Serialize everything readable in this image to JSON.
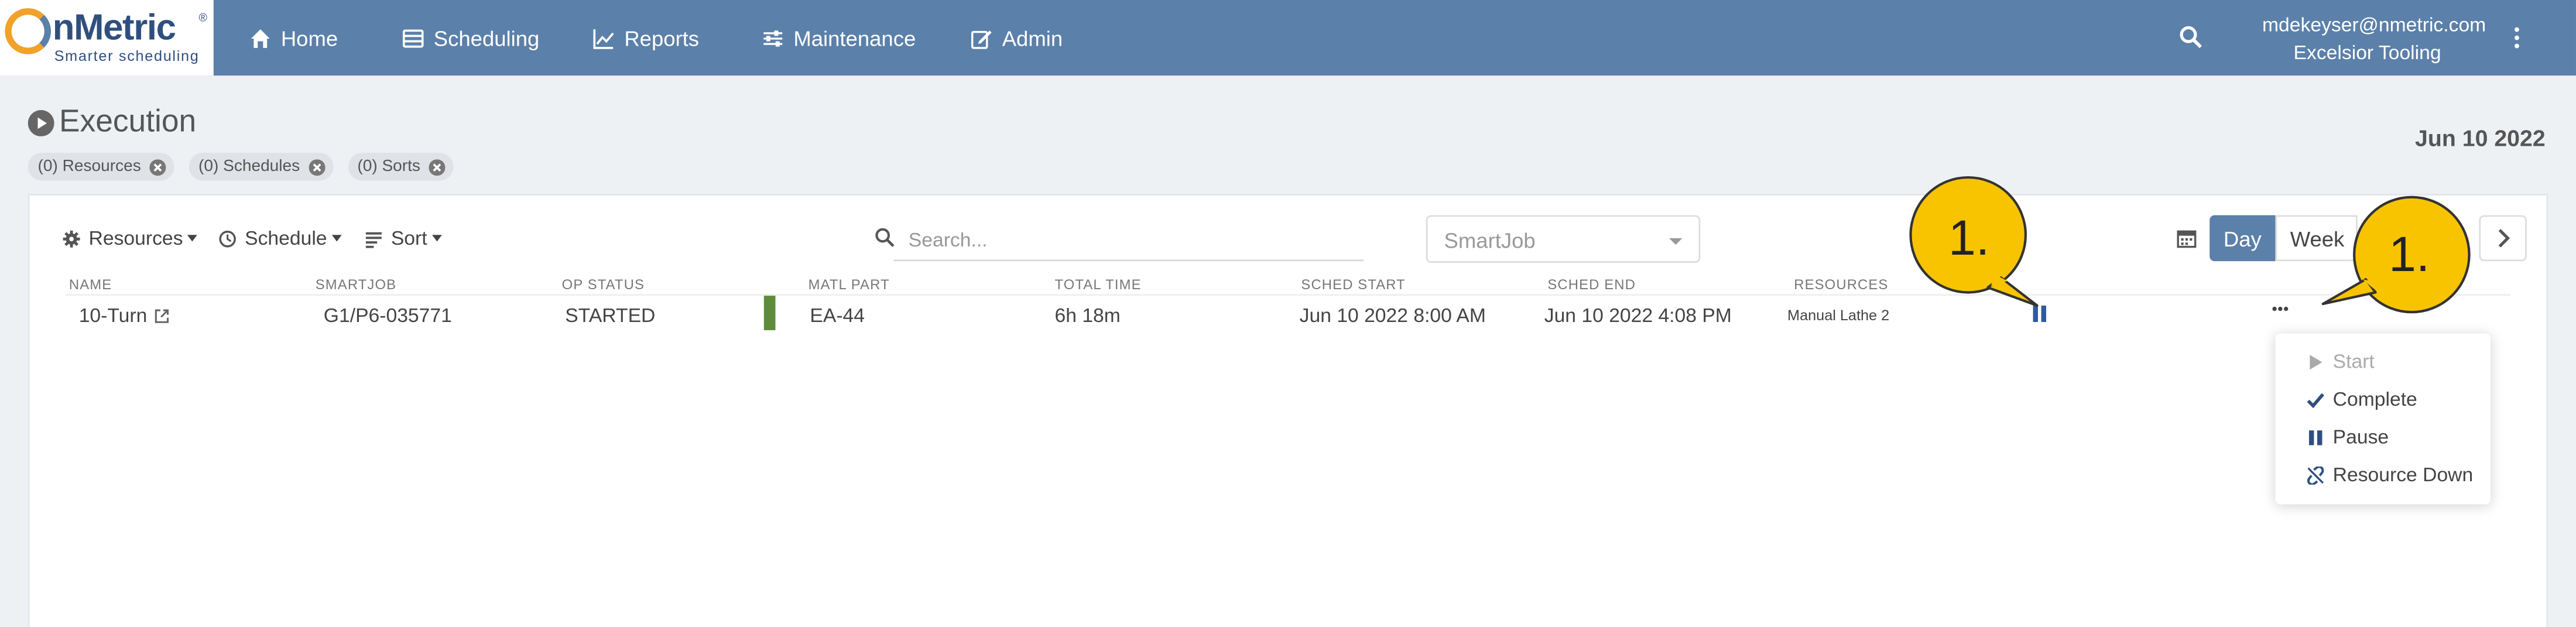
{
  "nav": {
    "logo_name": "nMetric",
    "logo_tagline": "Smarter scheduling",
    "items": [
      {
        "label": "Home",
        "icon": "home-icon"
      },
      {
        "label": "Scheduling",
        "icon": "calendar-list-icon"
      },
      {
        "label": "Reports",
        "icon": "chart-line-icon"
      },
      {
        "label": "Maintenance",
        "icon": "sliders-icon"
      },
      {
        "label": "Admin",
        "icon": "edit-icon"
      }
    ],
    "user_email": "mdekeyser@nmetric.com",
    "org": "Excelsior Tooling"
  },
  "page": {
    "title": "Execution",
    "date": "Jun 10 2022",
    "filter_chips": [
      "(0) Resources",
      "(0) Schedules",
      "(0) Sorts"
    ]
  },
  "toolbar": {
    "resources_label": "Resources",
    "schedule_label": "Schedule",
    "sort_label": "Sort",
    "search_placeholder": "Search...",
    "select_value": "SmartJob",
    "day_label": "Day",
    "week_label": "Week"
  },
  "table": {
    "columns": [
      "NAME",
      "SMARTJOB",
      "OP STATUS",
      "MATL PART",
      "TOTAL TIME",
      "SCHED START",
      "SCHED END",
      "RESOURCES"
    ],
    "rows": [
      {
        "name": "10-Turn",
        "smartjob": "G1/P6-035771",
        "op_status": "STARTED",
        "status_color": "#5e8c3a",
        "matl_part": "EA-44",
        "total_time": "6h 18m",
        "sched_start": "Jun 10 2022 8:00 AM",
        "sched_end": "Jun 10 2022 4:08 PM",
        "resources": "Manual Lathe 2"
      }
    ]
  },
  "row_menu": {
    "items": [
      {
        "label": "Start",
        "icon": "play-icon",
        "disabled": true
      },
      {
        "label": "Complete",
        "icon": "check-icon",
        "disabled": false
      },
      {
        "label": "Pause",
        "icon": "pause-icon",
        "disabled": false
      },
      {
        "label": "Resource Down",
        "icon": "unlink-icon",
        "disabled": false
      }
    ]
  },
  "callouts": [
    "1.",
    "1."
  ],
  "colors": {
    "nav_bg": "#5b80aa",
    "accent": "#5b80aa",
    "callout": "#f8c400",
    "status_started": "#5e8c3a"
  }
}
